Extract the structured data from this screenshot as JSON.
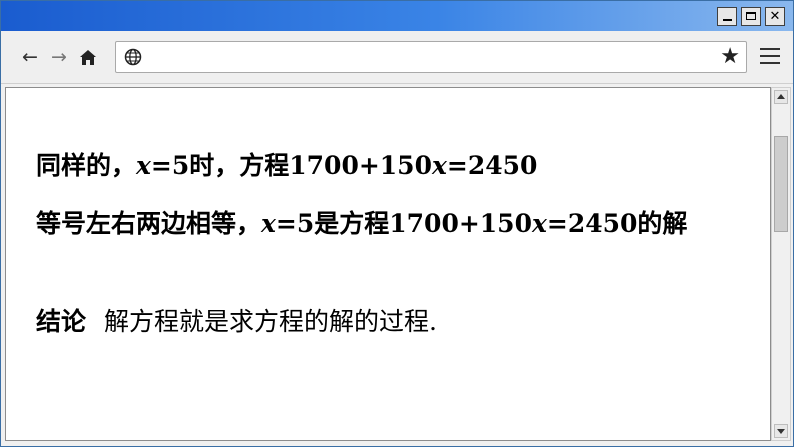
{
  "window": {
    "controls": {
      "minimize_icon": "minimize-icon",
      "maximize_icon": "maximize-icon",
      "close_icon": "close-icon",
      "close_glyph": "✕"
    }
  },
  "toolbar": {
    "back_glyph": "←",
    "forward_glyph": "→",
    "url_value": "",
    "bookmark_glyph": "★"
  },
  "content": {
    "line1": {
      "prefix": "同样的，",
      "var1": "x",
      "mid": "=5时，方程1700+150",
      "var2": "x",
      "suffix": "=2450"
    },
    "line2": {
      "prefix": "等号左右两边相等，",
      "var1": "x",
      "mid": "=5是方程1700+150",
      "var2": "x",
      "suffix": "=2450的解"
    },
    "line3": {
      "label": "结论",
      "text": "解方程就是求方程的解的过程."
    }
  },
  "colors": {
    "titlebar": "#1a5ccf",
    "page_bg": "#ffffff",
    "chrome": "#efefef"
  }
}
